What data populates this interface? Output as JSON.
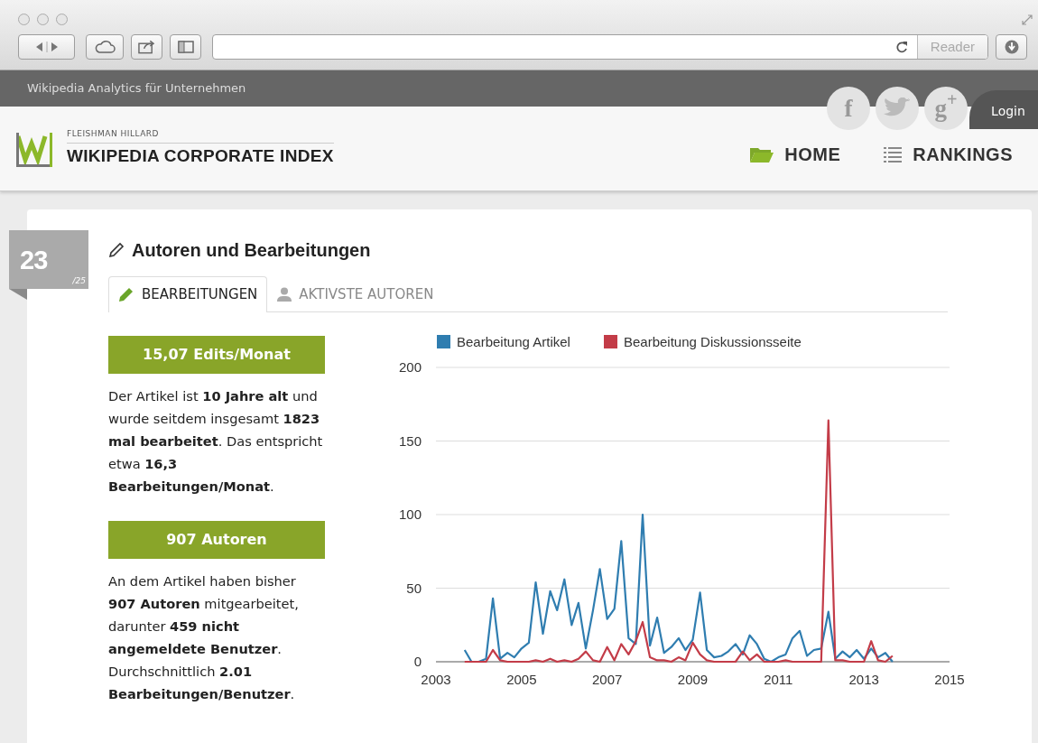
{
  "browser": {
    "reader_label": "Reader"
  },
  "topbar": {
    "tagline": "Wikipedia Analytics für Unternehmen",
    "social": [
      {
        "kind": "facebook",
        "glyph": "f"
      },
      {
        "kind": "twitter"
      },
      {
        "kind": "googleplus",
        "glyph": "g$^{+}$"
      }
    ],
    "login": "Login"
  },
  "header": {
    "brand_small": "FLEISHMAN HILLARD",
    "brand_title": "WIKIPEDIA CORPORATE INDEX",
    "nav": [
      {
        "label": "HOME",
        "kind": "folder"
      },
      {
        "label": "RANKINGS",
        "kind": "list"
      }
    ]
  },
  "section": {
    "rank": "23",
    "rank_total": "/25",
    "title": "Autoren und Bearbeitungen",
    "tabs": [
      {
        "label": "BEARBEITUNGEN",
        "kind": "pencil",
        "selected": true
      },
      {
        "label": "AKTIVSTE AUTOREN",
        "kind": "person",
        "selected": false
      }
    ],
    "stats": [
      {
        "value": "15,07 Edits/Monat",
        "text": "Der Artikel ist **10 Jahre alt** und wurde seitdem insgesamt **1823 mal bearbeitet**. Das entspricht etwa **16,3 Bearbeitungen/Monat**."
      },
      {
        "value": "907 Autoren",
        "text": "An dem Artikel haben bisher **907 Autoren** mitgearbeitet, darunter **459 nicht angemeldete Benutzer**. Durchschnittlich **2.01 Bearbeitungen/Benutzer**."
      }
    ],
    "chart_data": {
      "type": "line",
      "grid": true,
      "legend": true,
      "xlim": [
        2003,
        2015
      ],
      "ylim": [
        0,
        200
      ],
      "xticks": [
        2003,
        2005,
        2007,
        2009,
        2011,
        2013,
        2015
      ],
      "yticks": [
        0,
        50,
        100,
        150,
        200
      ],
      "x": [
        2003.67,
        2003.83,
        2004,
        2004.17,
        2004.33,
        2004.5,
        2004.67,
        2004.83,
        2005,
        2005.17,
        2005.33,
        2005.5,
        2005.67,
        2005.83,
        2006,
        2006.17,
        2006.33,
        2006.5,
        2006.67,
        2006.83,
        2007,
        2007.17,
        2007.33,
        2007.5,
        2007.67,
        2007.83,
        2008,
        2008.17,
        2008.33,
        2008.5,
        2008.67,
        2008.83,
        2009,
        2009.17,
        2009.33,
        2009.5,
        2009.67,
        2009.83,
        2010,
        2010.17,
        2010.33,
        2010.5,
        2010.67,
        2010.83,
        2011,
        2011.17,
        2011.33,
        2011.5,
        2011.67,
        2011.83,
        2012,
        2012.17,
        2012.33,
        2012.5,
        2012.67,
        2012.83,
        2013,
        2013.17,
        2013.33,
        2013.5,
        2013.67
      ],
      "series": [
        {
          "name": "Bearbeitung Artikel",
          "color": "#2f7db0",
          "values": [
            8,
            0,
            0,
            2,
            43,
            2,
            6,
            3,
            9,
            13,
            54,
            19,
            48,
            35,
            56,
            25,
            40,
            9,
            35,
            63,
            29,
            36,
            82,
            16,
            12,
            100,
            11,
            30,
            6,
            10,
            16,
            8,
            15,
            47,
            8,
            3,
            4,
            7,
            12,
            5,
            18,
            12,
            2,
            0,
            3,
            5,
            16,
            21,
            4,
            8,
            9,
            34,
            2,
            7,
            3,
            8,
            2,
            9,
            3,
            6,
            0
          ]
        },
        {
          "name": "Bearbeitung Diskussionsseite",
          "color": "#c33c48",
          "values": [
            0,
            0,
            0,
            0,
            8,
            1,
            0,
            0,
            0,
            0,
            1,
            0,
            2,
            0,
            1,
            0,
            2,
            7,
            1,
            0,
            10,
            1,
            12,
            5,
            14,
            27,
            3,
            1,
            1,
            0,
            3,
            1,
            13,
            5,
            1,
            0,
            0,
            0,
            0,
            7,
            1,
            5,
            0,
            0,
            0,
            1,
            0,
            0,
            0,
            0,
            0,
            164,
            1,
            1,
            0,
            0,
            0,
            14,
            1,
            0,
            4
          ]
        }
      ]
    }
  }
}
